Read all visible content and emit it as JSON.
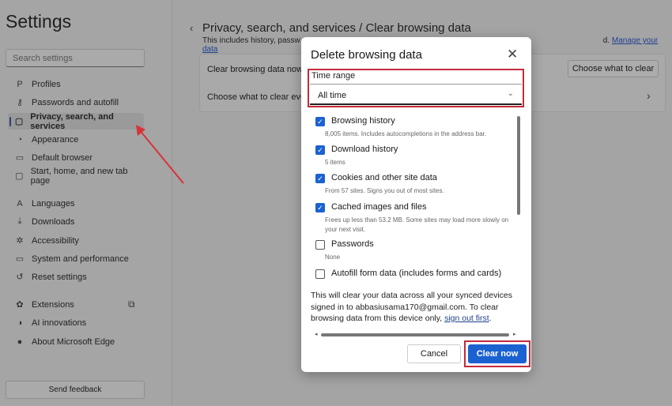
{
  "sidebar": {
    "title": "Settings",
    "search_placeholder": "Search settings",
    "items": [
      {
        "label": "Profiles",
        "icon": "P"
      },
      {
        "label": "Passwords and autofill",
        "icon": "⚷"
      },
      {
        "label": "Privacy, search, and services",
        "icon": "▢"
      },
      {
        "label": "Appearance",
        "icon": "◔"
      },
      {
        "label": "Default browser",
        "icon": "▭"
      },
      {
        "label": "Start, home, and new tab page",
        "icon": "▢"
      },
      {
        "label": "Languages",
        "icon": "A"
      },
      {
        "label": "Downloads",
        "icon": "⤓"
      },
      {
        "label": "Accessibility",
        "icon": "✲"
      },
      {
        "label": "System and performance",
        "icon": "▭"
      },
      {
        "label": "Reset settings",
        "icon": "↺"
      },
      {
        "label": "Extensions",
        "icon": "✿"
      },
      {
        "label": "AI innovations",
        "icon": "◑"
      },
      {
        "label": "About Microsoft Edge",
        "icon": "●"
      }
    ],
    "send_feedback": "Send feedback"
  },
  "main": {
    "breadcrumb": "Privacy, search, and services / Clear browsing data",
    "subtitle_start": "This includes history, passw",
    "subtitle_end": "d.",
    "manage_link": "Manage your data",
    "row1": "Clear browsing data now",
    "row2": "Choose what to clear every",
    "choose_button": "Choose what to clear"
  },
  "dialog": {
    "title": "Delete browsing data",
    "time_range_label": "Time range",
    "time_range_value": "All time",
    "options": [
      {
        "label": "Browsing history",
        "desc": "8,005 items. Includes autocompletions in the address bar.",
        "checked": true
      },
      {
        "label": "Download history",
        "desc": "5 items",
        "checked": true
      },
      {
        "label": "Cookies and other site data",
        "desc": "From 57 sites. Signs you out of most sites.",
        "checked": true
      },
      {
        "label": "Cached images and files",
        "desc": "Frees up less than 53.2 MB. Some sites may load more slowly on your next visit.",
        "checked": true
      },
      {
        "label": "Passwords",
        "desc": "None",
        "checked": false
      },
      {
        "label": "Autofill form data (includes forms and cards)",
        "checked": false
      }
    ],
    "note": "This will clear your data across all your synced devices signed in to abbasiusama170@gmail.com. To clear browsing data from this device only, ",
    "note_link": "sign out first",
    "note_end": ".",
    "cancel": "Cancel",
    "clear_now": "Clear now"
  },
  "colors": {
    "accent": "#1b62d1",
    "highlight": "#c42b3a"
  }
}
